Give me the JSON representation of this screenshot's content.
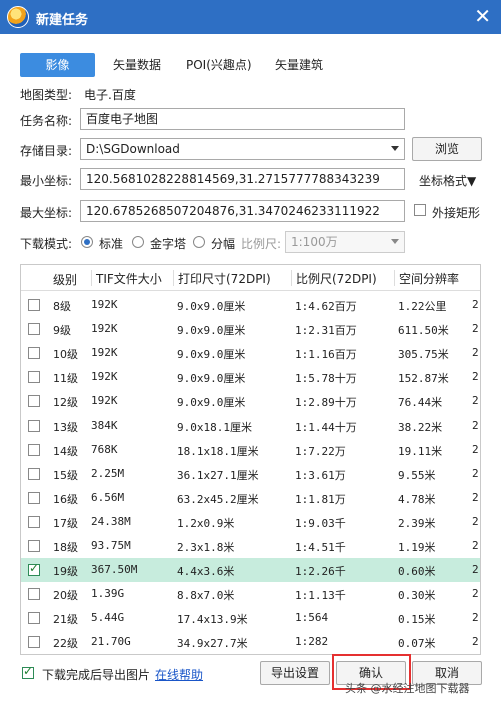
{
  "window": {
    "title": "新建任务",
    "close_glyph": "✕"
  },
  "tabs": [
    {
      "label": "影像",
      "active": true
    },
    {
      "label": "矢量数据",
      "active": false
    },
    {
      "label": "POI(兴趣点)",
      "active": false
    },
    {
      "label": "矢量建筑",
      "active": false
    }
  ],
  "map_type": {
    "label": "地图类型:",
    "value": "电子.百度"
  },
  "task_name": {
    "label": "任务名称:",
    "value": "百度电子地图"
  },
  "storage_dir": {
    "label": "存储目录:",
    "value": "D:\\SGDownload",
    "browse_label": "浏览"
  },
  "min_coord": {
    "label": "最小坐标:",
    "value": "120.5681028228814569,31.2715777788343239",
    "format_label": "坐标格式▼"
  },
  "max_coord": {
    "label": "最大坐标:",
    "value": "120.6785268507204876,31.3470246233111922",
    "outer_rect_label": "外接矩形",
    "outer_rect_checked": false
  },
  "download_mode": {
    "label": "下载模式:",
    "options": [
      {
        "label": "标准",
        "selected": true
      },
      {
        "label": "金字塔",
        "selected": false
      },
      {
        "label": "分幅",
        "selected": false
      }
    ],
    "scale_label": "比例尺:",
    "scale_value": "1:100万"
  },
  "table": {
    "headers": [
      "级别",
      "TIF文件大小",
      "打印尺寸(72DPI)",
      "比例尺(72DPI)",
      "空间分辨率"
    ],
    "rows": [
      {
        "level": "8级",
        "size": "192K",
        "print": "9.0x9.0厘米",
        "scale": "1:4.62百万",
        "res": "1.22公里",
        "extra": "2",
        "checked": false
      },
      {
        "level": "9级",
        "size": "192K",
        "print": "9.0x9.0厘米",
        "scale": "1:2.31百万",
        "res": "611.50米",
        "extra": "2",
        "checked": false
      },
      {
        "level": "10级",
        "size": "192K",
        "print": "9.0x9.0厘米",
        "scale": "1:1.16百万",
        "res": "305.75米",
        "extra": "2",
        "checked": false
      },
      {
        "level": "11级",
        "size": "192K",
        "print": "9.0x9.0厘米",
        "scale": "1:5.78十万",
        "res": "152.87米",
        "extra": "2",
        "checked": false
      },
      {
        "level": "12级",
        "size": "192K",
        "print": "9.0x9.0厘米",
        "scale": "1:2.89十万",
        "res": "76.44米",
        "extra": "2",
        "checked": false
      },
      {
        "level": "13级",
        "size": "384K",
        "print": "9.0x18.1厘米",
        "scale": "1:1.44十万",
        "res": "38.22米",
        "extra": "2",
        "checked": false
      },
      {
        "level": "14级",
        "size": "768K",
        "print": "18.1x18.1厘米",
        "scale": "1:7.22万",
        "res": "19.11米",
        "extra": "2",
        "checked": false
      },
      {
        "level": "15级",
        "size": "2.25M",
        "print": "36.1x27.1厘米",
        "scale": "1:3.61万",
        "res": "9.55米",
        "extra": "2",
        "checked": false
      },
      {
        "level": "16级",
        "size": "6.56M",
        "print": "63.2x45.2厘米",
        "scale": "1:1.81万",
        "res": "4.78米",
        "extra": "2",
        "checked": false
      },
      {
        "level": "17级",
        "size": "24.38M",
        "print": "1.2x0.9米",
        "scale": "1:9.03千",
        "res": "2.39米",
        "extra": "2",
        "checked": false
      },
      {
        "level": "18级",
        "size": "93.75M",
        "print": "2.3x1.8米",
        "scale": "1:4.51千",
        "res": "1.19米",
        "extra": "2",
        "checked": false
      },
      {
        "level": "19级",
        "size": "367.50M",
        "print": "4.4x3.6米",
        "scale": "1:2.26千",
        "res": "0.60米",
        "extra": "2",
        "checked": true
      },
      {
        "level": "20级",
        "size": "1.39G",
        "print": "8.8x7.0米",
        "scale": "1:1.13千",
        "res": "0.30米",
        "extra": "2",
        "checked": false
      },
      {
        "level": "21级",
        "size": "5.44G",
        "print": "17.4x13.9米",
        "scale": "1:564",
        "res": "0.15米",
        "extra": "2",
        "checked": false
      },
      {
        "level": "22级",
        "size": "21.70G",
        "print": "34.9x27.7米",
        "scale": "1:282",
        "res": "0.07米",
        "extra": "2",
        "checked": false
      }
    ]
  },
  "footer": {
    "export_after_label": "下载完成后导出图片",
    "export_after_checked": true,
    "help_link": "在线帮助",
    "export_settings_label": "导出设置",
    "confirm_label": "确认",
    "cancel_label": "取消",
    "watermark": "头条 @水经注地图下载器"
  },
  "colors": {
    "titlebar": "#2e6fc4",
    "tab_active": "#3c8ce0",
    "row_selected": "#c7ecdd",
    "highlight_box": "#e53030"
  }
}
